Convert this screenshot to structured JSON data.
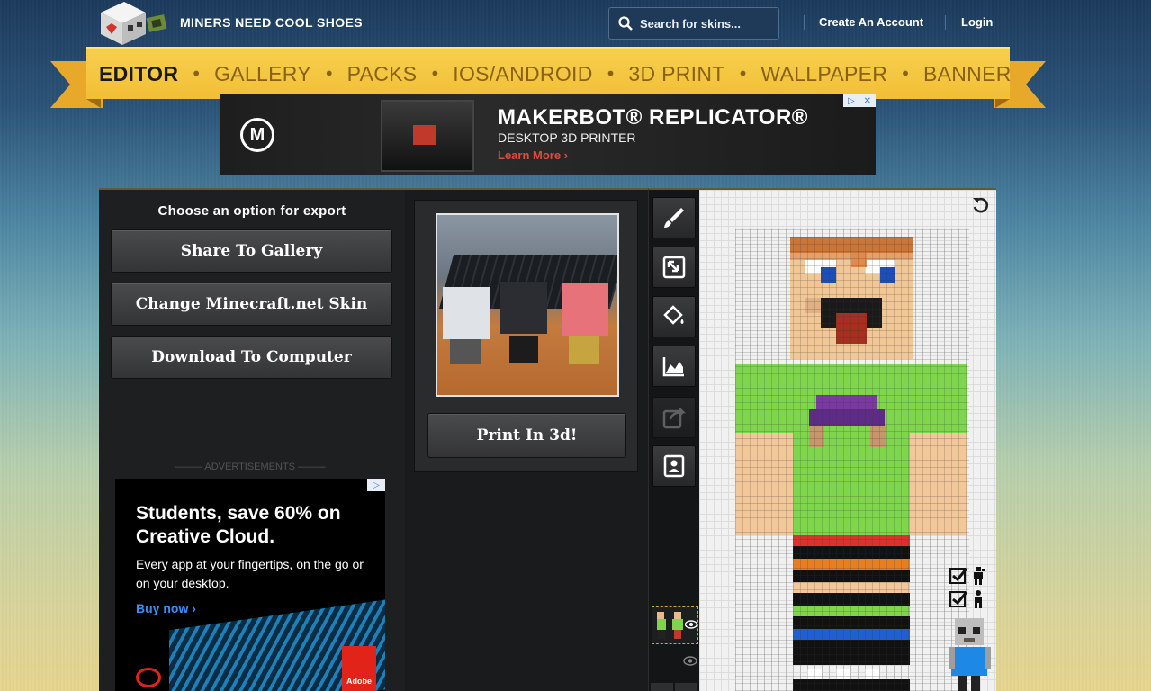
{
  "header": {
    "brand": "MINERS NEED COOL SHOES",
    "search_placeholder": "Search for skins...",
    "create_account": "Create An Account",
    "login": "Login"
  },
  "nav": {
    "items": [
      "EDITOR",
      "GALLERY",
      "PACKS",
      "IOS/ANDROID",
      "3D PRINT",
      "WALLPAPER",
      "BANNER"
    ],
    "active": "EDITOR"
  },
  "ad_top": {
    "title": "MAKERBOT® REPLICATOR®",
    "subtitle": "DESKTOP 3D PRINTER",
    "cta": "Learn More ›"
  },
  "export": {
    "title": "Choose an option for export",
    "share_label": "Share To Gallery",
    "change_label": "Change Minecraft.net Skin",
    "download_label": "Download To Computer"
  },
  "ads_label": "––––– ADVERTISEMENTS –––––",
  "ad_side": {
    "headline": "Students, save 60% on Creative Cloud.",
    "sub": "Every app at your fingertips, on the go or on your desktop.",
    "cta": "Buy now ›",
    "brand": "Adobe"
  },
  "print": {
    "button_label": "Print In 3d!"
  },
  "tools": [
    "brush-icon",
    "resize-icon",
    "bucket-icon",
    "noise-icon",
    "share-icon",
    "contact-icon"
  ],
  "colors": {
    "ribbon": "#f2bf36",
    "panel": "#1e1f21",
    "accent": "#c7a92b"
  }
}
